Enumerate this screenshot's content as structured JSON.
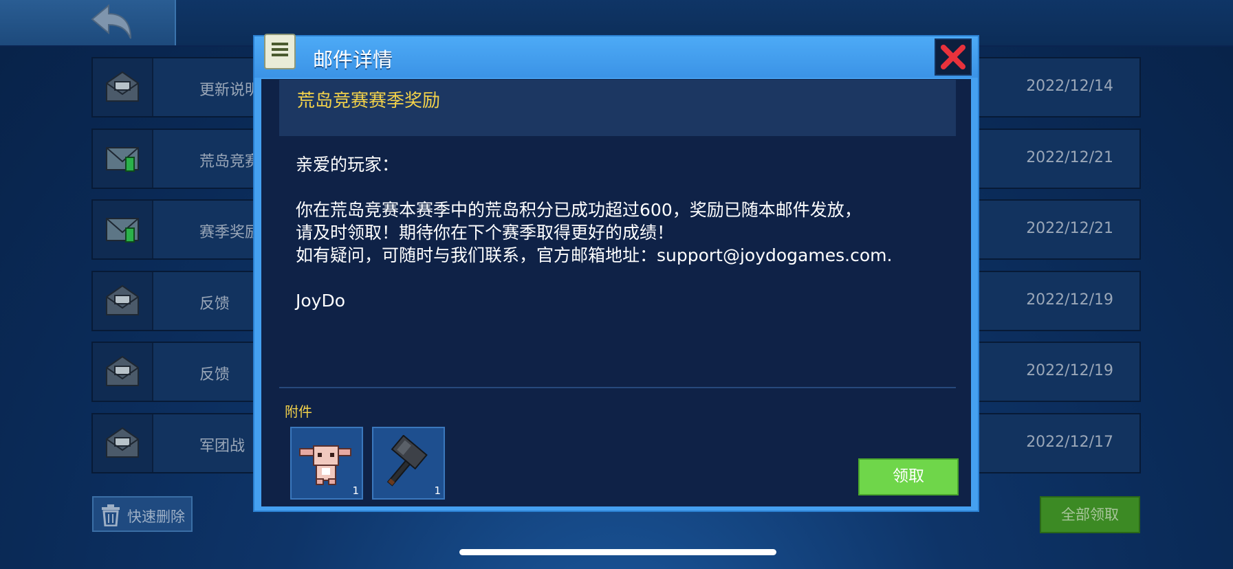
{
  "background": {
    "mail_list": [
      {
        "subject": "更新说明",
        "date": "2022/12/14",
        "icon": "envelope-open-icon"
      },
      {
        "subject": "荒岛竞赛",
        "date": "2022/12/21",
        "icon": "envelope-attachment-icon"
      },
      {
        "subject": "赛季奖励",
        "date": "2022/12/21",
        "icon": "envelope-attachment-icon"
      },
      {
        "subject": "反馈",
        "date": "2022/12/19",
        "icon": "envelope-open-icon"
      },
      {
        "subject": "反馈",
        "date": "2022/12/19",
        "icon": "envelope-open-icon"
      },
      {
        "subject": "军团战",
        "date": "2022/12/17",
        "icon": "envelope-open-icon"
      }
    ],
    "quick_delete_label": "快速删除",
    "claim_all_label": "全部领取"
  },
  "dialog": {
    "title": "邮件详情",
    "mail_title": "荒岛竞赛赛季奖励",
    "greeting": "亲爱的玩家：",
    "body_lines": [
      "你在荒岛竞赛本赛季中的荒岛积分已成功超过600，奖励已随本邮件发放，",
      "请及时领取！期待你在下个赛季取得更好的成绩！",
      "如有疑问，可随时与我们联系，官方邮箱地址：support@joydogames.com."
    ],
    "signature": "JoyDo",
    "attachments_label": "附件",
    "attachments": [
      {
        "name": "bunny-pet-icon",
        "count": "1"
      },
      {
        "name": "hammer-weapon-icon",
        "count": "1"
      }
    ],
    "claim_label": "领取"
  },
  "colors": {
    "accent_blue": "#45a0f0",
    "title_yellow": "#f3d24a",
    "claim_green": "#6fd64a",
    "close_red": "#e8323c"
  }
}
